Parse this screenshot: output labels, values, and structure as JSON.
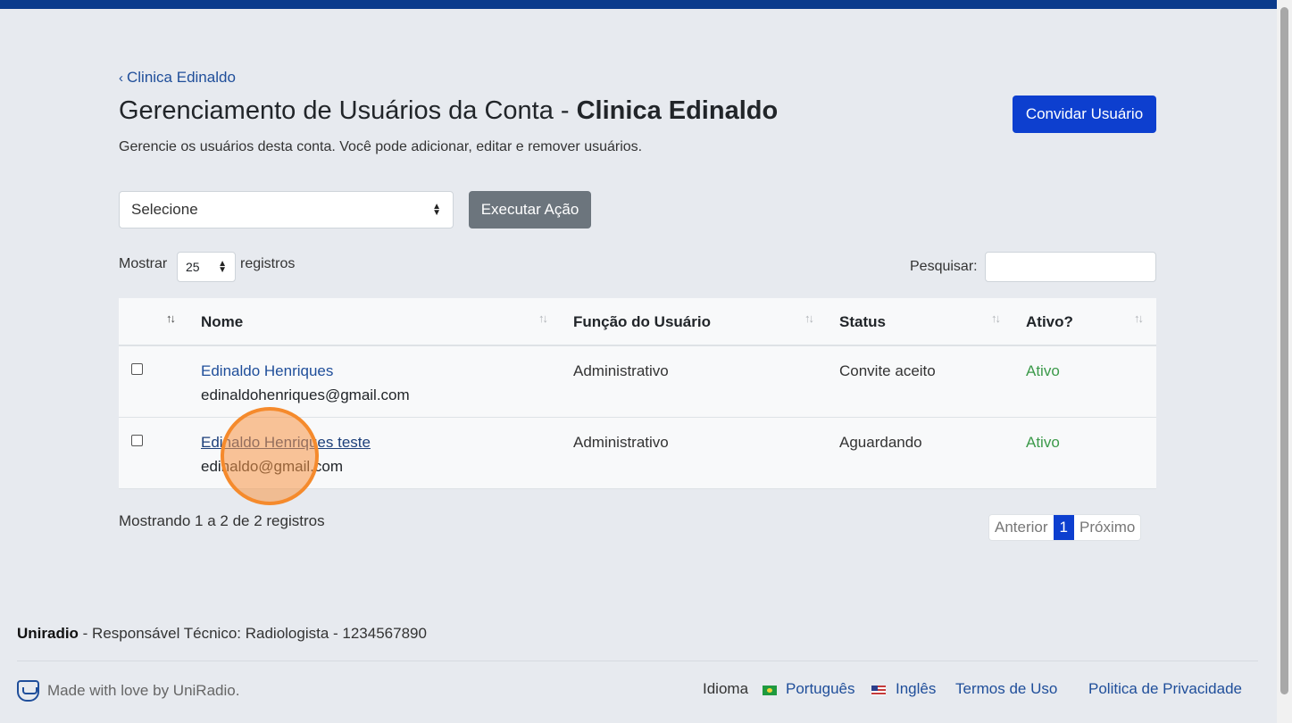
{
  "breadcrumb": {
    "label": "Clinica Edinaldo"
  },
  "header": {
    "title_prefix": "Gerenciamento de Usuários da Conta - ",
    "title_account": "Clinica Edinaldo",
    "subtitle": "Gerencie os usuários desta conta. Você pode adicionar, editar e remover usuários.",
    "invite_label": "Convidar Usuário"
  },
  "actions": {
    "select_value": "Selecione",
    "execute_label": "Executar Ação"
  },
  "table_controls": {
    "show_label": "Mostrar",
    "page_size": "25",
    "show_suffix": "registros",
    "search_label": "Pesquisar:",
    "search_value": ""
  },
  "table": {
    "columns": [
      "Nome",
      "Função do Usuário",
      "Status",
      "Ativo?"
    ],
    "rows": [
      {
        "name": "Edinaldo Henriques",
        "email": "edinaldohenriques@gmail.com",
        "role": "Administrativo",
        "status": "Convite aceito",
        "active": "Ativo"
      },
      {
        "name": "Edinaldo Henriques teste",
        "email": "edinaldo@gmail.com",
        "role": "Administrativo",
        "status": "Aguardando",
        "active": "Ativo"
      }
    ]
  },
  "pagination": {
    "summary": "Mostrando 1 a 2 de 2 registros",
    "prev": "Anterior",
    "current": "1",
    "next": "Próximo"
  },
  "footer": {
    "brand": "Uniradio",
    "responsible": " - Responsável Técnico: Radiologista - 1234567890",
    "made_with": "Made with love by UniRadio.",
    "language_label": "Idioma",
    "lang_pt": "Português",
    "lang_en": "Inglês",
    "terms": "Termos de Uso",
    "privacy": "Politica de Privacidade"
  },
  "colors": {
    "primary": "#0d3fcf",
    "link": "#1f4e9a",
    "active_text": "#3c9a4a",
    "secondary_button": "#6c757d"
  }
}
